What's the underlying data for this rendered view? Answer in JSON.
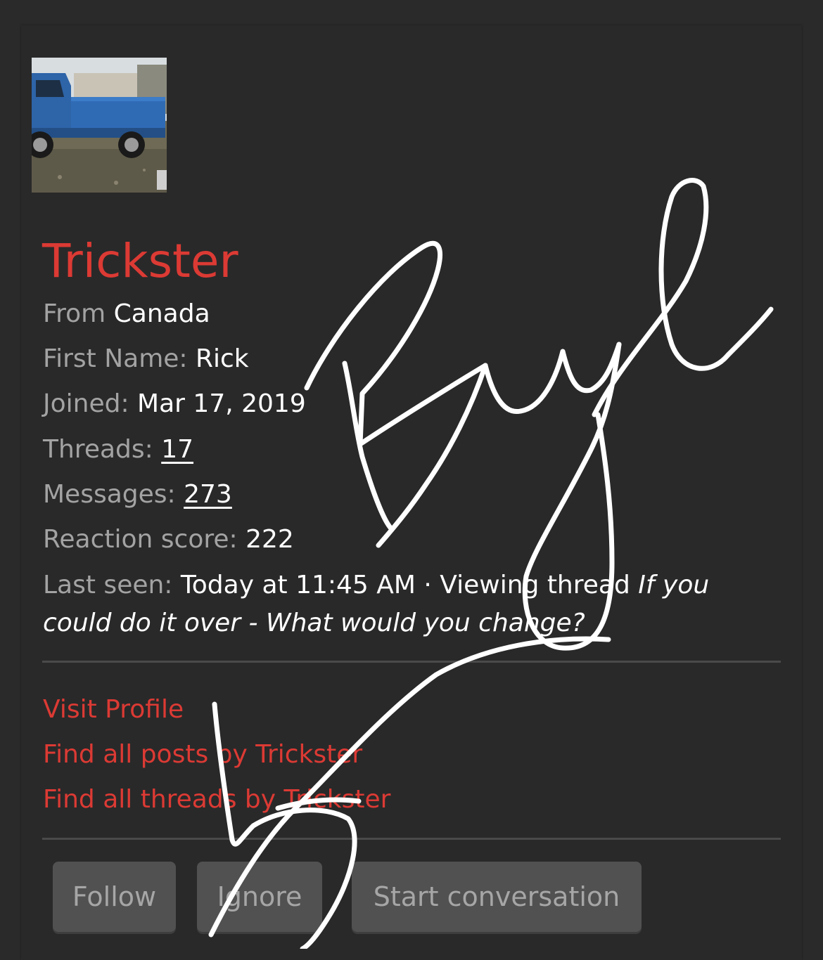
{
  "profile": {
    "username": "Trickster",
    "avatar_alt": "blue-mini-truck-avatar",
    "from_label": "From",
    "from_value": "Canada",
    "first_name_label": "First Name:",
    "first_name_value": "Rick",
    "joined_label": "Joined:",
    "joined_value": "Mar 17, 2019",
    "threads_label": "Threads:",
    "threads_value": "17",
    "messages_label": "Messages:",
    "messages_value": "273",
    "reaction_label": "Reaction score:",
    "reaction_value": "222",
    "last_seen_label": "Last seen:",
    "last_seen_value": "Today at 11:45 AM · Viewing thread",
    "last_seen_thread": "If you could do it over - What would you change?"
  },
  "links": {
    "visit_profile": "Visit Profile",
    "find_posts": "Find all posts by Trickster",
    "find_threads": "Find all threads by Trickster"
  },
  "buttons": {
    "follow": "Follow",
    "ignore": "Ignore",
    "start_conversation": "Start conversation"
  },
  "overlay": {
    "handwriting": "Bye"
  },
  "colors": {
    "background": "#292929",
    "accent": "#dc3a34",
    "label": "#a3a3a3",
    "value": "#ffffff",
    "button_bg": "#515151",
    "button_text": "#a6a6a6"
  }
}
